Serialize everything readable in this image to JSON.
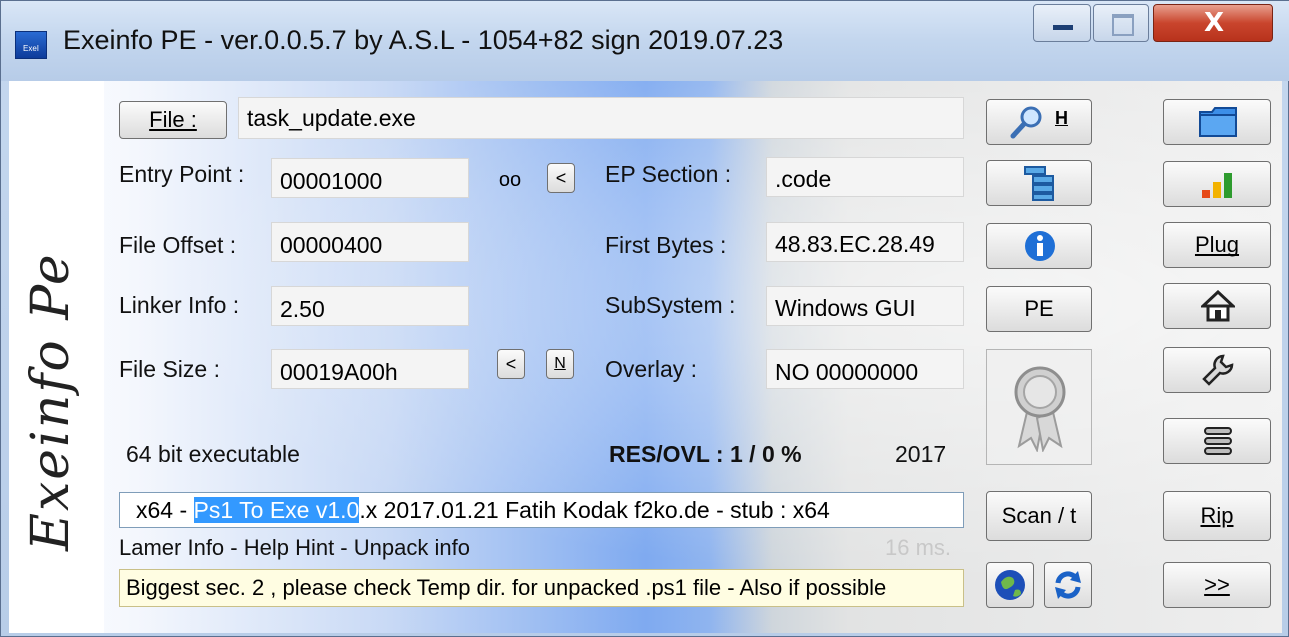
{
  "window": {
    "title": "Exeinfo PE - ver.0.0.5.7  by A.S.L -  1054+82 sign  2019.07.23",
    "icon_text": "ExeI",
    "close_glyph": "X"
  },
  "watermark": "Exeinfo Pe",
  "file": {
    "button_label": "File :",
    "value": "task_update.exe"
  },
  "left_fields": [
    {
      "label": "Entry Point :",
      "value": "00001000"
    },
    {
      "label": "File Offset :",
      "value": "00000400"
    },
    {
      "label": "Linker Info :",
      "value": "2.50"
    },
    {
      "label": "File Size :",
      "value": "00019A00h"
    }
  ],
  "small_buttons": {
    "oo": "oo",
    "lt1": "<",
    "lt2": "<",
    "n": "N"
  },
  "right_fields": [
    {
      "label": "EP Section :",
      "value": ".code"
    },
    {
      "label": "First Bytes :",
      "value": "48.83.EC.28.49"
    },
    {
      "label": "SubSystem :",
      "value": "Windows GUI"
    },
    {
      "label": "Overlay :",
      "value": "NO   00000000"
    }
  ],
  "status": {
    "bitness": "64 bit executable",
    "res_ovl": "RES/OVL : 1 / 0 %",
    "year": "2017"
  },
  "scan": {
    "prefix": "x64 - ",
    "highlight": "Ps1 To Exe  v1.0",
    "suffix": ".x  2017.01.21 Fatih Kodak  f2ko.de - stub :  x64"
  },
  "lamer": {
    "label": "Lamer Info - Help Hint - Unpack info",
    "timing": "16 ms."
  },
  "info_text": "Biggest sec. 2 , please check Temp dir. for unpacked .ps1 file - Also if possible",
  "mid_buttons": {
    "h_label": "H",
    "pe_label": "PE",
    "scan_label": "Scan / t"
  },
  "right_buttons": {
    "plug_label": "Plug",
    "rip_label": "Rip",
    "next_label": ">>"
  }
}
